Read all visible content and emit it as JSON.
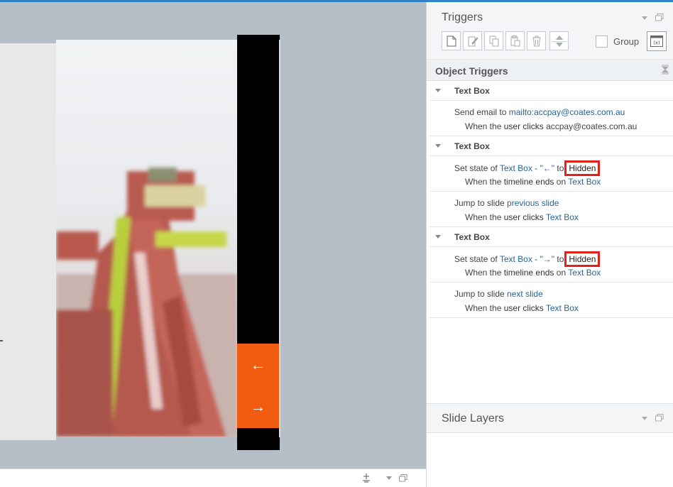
{
  "slide": {
    "arrow_left": "←",
    "arrow_right": "→",
    "accent_color": "#f15c10"
  },
  "triggers_panel": {
    "title": "Triggers",
    "toolbar": {
      "icons": [
        "new-trigger-icon",
        "edit-trigger-icon",
        "copy-icon",
        "paste-icon",
        "delete-icon",
        "move-up-down-icon",
        "variables-icon"
      ],
      "group_label": "Group"
    }
  },
  "object_triggers": {
    "title": "Object Triggers",
    "groups": [
      {
        "name": "Text Box",
        "items": [
          {
            "action": "Send email to",
            "target": "mailto:accpay@coates.com.au",
            "when_prefix": "When the",
            "when_event": "user clicks",
            "when_object": "accpay@coates.com.au"
          }
        ]
      },
      {
        "name": "Text Box",
        "items": [
          {
            "action": "Set state of",
            "object": "Text Box - \"←\"",
            "to": "to",
            "state": "Hidden",
            "when_prefix": "When the",
            "when_event": "timeline ends",
            "on": "on",
            "when_object": "Text Box"
          },
          {
            "action": "Jump to slide",
            "target": "previous slide",
            "when_prefix": "When the",
            "when_event": "user clicks",
            "when_object": "Text Box"
          }
        ]
      },
      {
        "name": "Text Box",
        "items": [
          {
            "action": "Set state of",
            "object": "Text Box - \"→\"",
            "to": "to",
            "state": "Hidden",
            "when_prefix": "When the",
            "when_event": "timeline ends",
            "on": "on",
            "when_object": "Text Box"
          },
          {
            "action": "Jump to slide",
            "target": "next slide",
            "when_prefix": "When the",
            "when_event": "user clicks",
            "when_object": "Text Box"
          }
        ]
      }
    ]
  },
  "slide_layers": {
    "title": "Slide Layers"
  }
}
